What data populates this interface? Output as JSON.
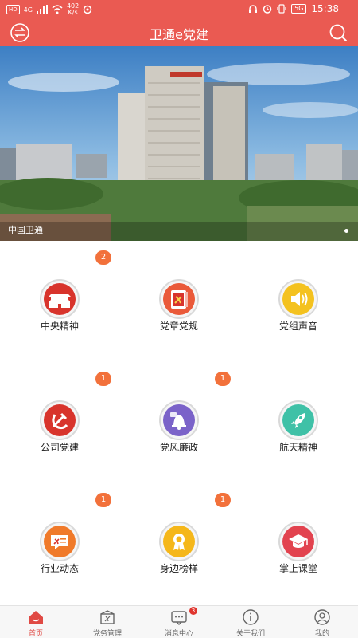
{
  "status_bar": {
    "hd": "HD",
    "signal": "4G",
    "speed_value": "402",
    "speed_unit": "K/s",
    "battery": "5G",
    "time": "15:38"
  },
  "app_bar": {
    "title": "卫通e党建"
  },
  "banner": {
    "caption": "中国卫通"
  },
  "grid": [
    {
      "label": "中央精神",
      "badge": "2"
    },
    {
      "label": "党章党规",
      "badge": ""
    },
    {
      "label": "党组声音",
      "badge": ""
    },
    {
      "label": "公司党建",
      "badge": "1"
    },
    {
      "label": "党风廉政",
      "badge": "1"
    },
    {
      "label": "航天精神",
      "badge": ""
    },
    {
      "label": "行业动态",
      "badge": "1"
    },
    {
      "label": "身边榜样",
      "badge": "1"
    },
    {
      "label": "掌上课堂",
      "badge": ""
    }
  ],
  "tabs": [
    {
      "label": "首页",
      "active": true
    },
    {
      "label": "党务管理",
      "active": false
    },
    {
      "label": "消息中心",
      "active": false,
      "badge": "3"
    },
    {
      "label": "关于我们",
      "active": false
    },
    {
      "label": "我的",
      "active": false
    }
  ],
  "colors": {
    "brand_red": "#ea5a52",
    "badge_orange": "#f2713b",
    "active_tab": "#e04a44"
  }
}
